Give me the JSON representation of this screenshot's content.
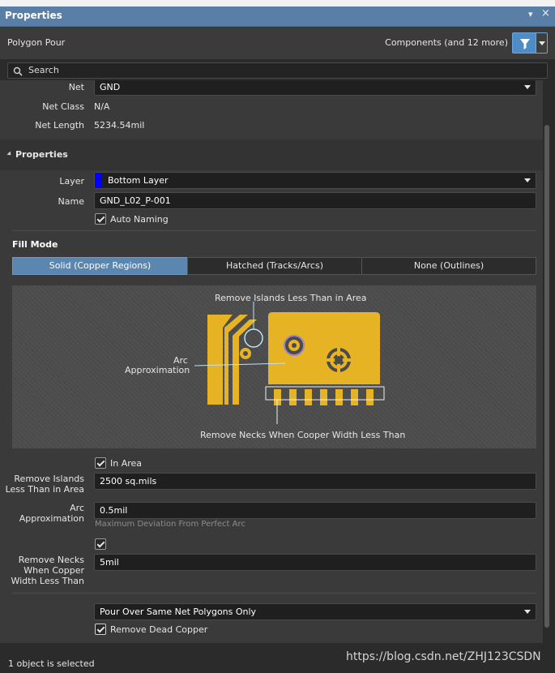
{
  "panel": {
    "title": "Properties",
    "pin_glyph": "▾",
    "close_glyph": "×",
    "object_type": "Polygon Pour",
    "filter_label": "Components (and 12 more)"
  },
  "search": {
    "placeholder": "Search"
  },
  "net_section": {
    "net_label": "Net",
    "net_value": "GND",
    "netclass_label": "Net Class",
    "netclass_value": "N/A",
    "netlength_label": "Net Length",
    "netlength_value": "5234.54mil"
  },
  "properties": {
    "heading": "Properties",
    "layer_label": "Layer",
    "layer_value": "Bottom Layer",
    "layer_color": "#0000ff",
    "name_label": "Name",
    "name_value": "GND_L02_P-001",
    "auto_naming_label": "Auto Naming",
    "auto_naming_checked": true
  },
  "fill_mode": {
    "title": "Fill Mode",
    "options": [
      "Solid (Copper Regions)",
      "Hatched (Tracks/Arcs)",
      "None (Outlines)"
    ],
    "selected": "Solid (Copper Regions)"
  },
  "diagram": {
    "label_islands": "Remove Islands Less Than in Area",
    "label_arc_1": "Arc",
    "label_arc_2": "Approximation",
    "label_necks": "Remove Necks When Cooper Width Less Than",
    "copper_color": "#e6b325"
  },
  "options": {
    "in_area_label": "In Area",
    "islands_label_1": "Remove Islands",
    "islands_label_2": "Less Than in Area",
    "islands_value": "2500 sq.mils",
    "arc_label_1": "Arc",
    "arc_label_2": "Approximation",
    "arc_value": "0.5mil",
    "arc_hint": "Maximum Deviation From Perfect Arc",
    "necks_label_1": "Remove Necks",
    "necks_label_2": "When Copper",
    "necks_label_3": "Width Less Than",
    "necks_value": "5mil",
    "pour_over_value": "Pour Over Same Net Polygons Only",
    "remove_dead_copper_label": "Remove Dead Copper"
  },
  "status": {
    "selection_text": "1 object is selected",
    "watermark": "https://blog.csdn.net/ZHJ123CSDN"
  }
}
